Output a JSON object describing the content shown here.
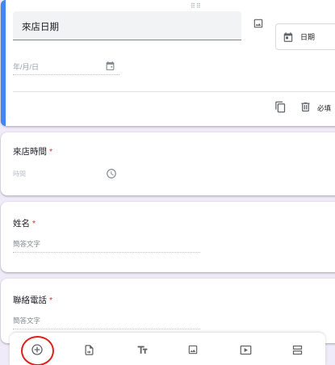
{
  "active_question": {
    "title": "來店日期",
    "type_label": "日期",
    "date_placeholder": "年/月/日",
    "required_label": "必填"
  },
  "questions": [
    {
      "title": "來店時間",
      "required_mark": "*",
      "placeholder": "時間"
    },
    {
      "title": "姓名",
      "required_mark": "*",
      "placeholder": "簡答文字"
    },
    {
      "title": "聯絡電話",
      "required_mark": "*",
      "placeholder": "簡答文字"
    }
  ],
  "toolbar": {
    "buttons": [
      "add-question",
      "import-questions",
      "add-title",
      "add-image",
      "add-video",
      "add-section"
    ]
  },
  "colors": {
    "accent": "#4285f4",
    "required": "#d93025",
    "highlight": "#e0201b",
    "background": "#f0ebf8"
  }
}
